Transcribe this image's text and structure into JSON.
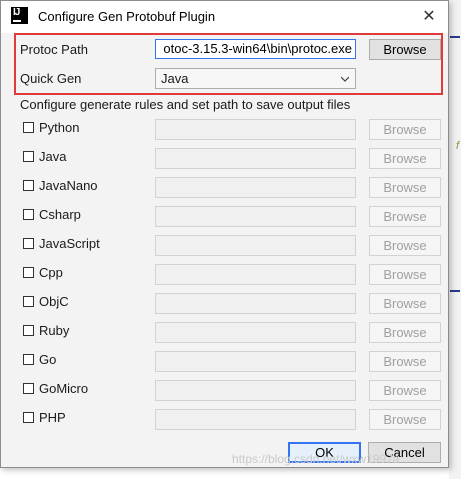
{
  "dialog": {
    "title": "Configure Gen Protobuf Plugin",
    "close_glyph": "✕",
    "app_icon_label": "IJ"
  },
  "protoc": {
    "label": "Protoc Path",
    "value": "otoc-3.15.3-win64\\bin\\protoc.exe",
    "browse_label": "Browse"
  },
  "quick_gen": {
    "label": "Quick Gen",
    "selected": "Java"
  },
  "section_label": "Configure generate rules and set path to save output files",
  "languages": [
    {
      "label": "Python",
      "browse_label": "Browse"
    },
    {
      "label": "Java",
      "browse_label": "Browse"
    },
    {
      "label": "JavaNano",
      "browse_label": "Browse"
    },
    {
      "label": "Csharp",
      "browse_label": "Browse"
    },
    {
      "label": "JavaScript",
      "browse_label": "Browse"
    },
    {
      "label": "Cpp",
      "browse_label": "Browse"
    },
    {
      "label": "ObjC",
      "browse_label": "Browse"
    },
    {
      "label": "Ruby",
      "browse_label": "Browse"
    },
    {
      "label": "Go",
      "browse_label": "Browse"
    },
    {
      "label": "GoMicro",
      "browse_label": "Browse"
    },
    {
      "label": "PHP",
      "browse_label": "Browse"
    }
  ],
  "footer": {
    "ok_label": "OK",
    "cancel_label": "Cancel"
  },
  "background": {
    "italic_glyph": "f"
  },
  "watermark": "https://blog.csdn.net/wxw1997a",
  "colors": {
    "highlight_border": "#e23a3a",
    "focus_blue": "#3574f0"
  }
}
